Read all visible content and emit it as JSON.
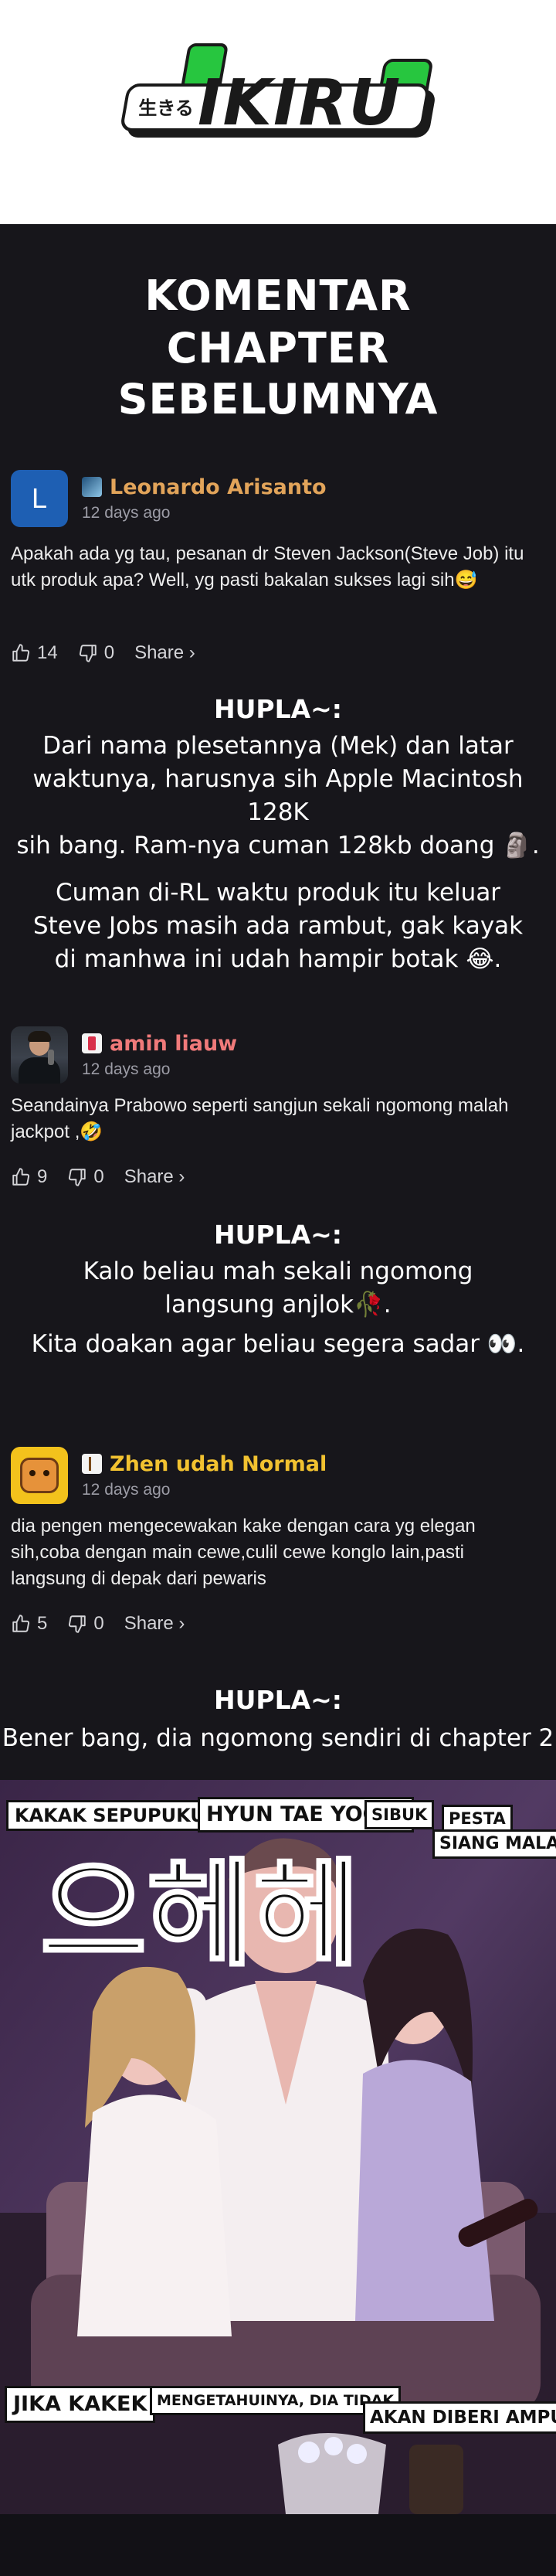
{
  "header": {
    "logo_jp": "生きる",
    "logo_text": "IKIRU"
  },
  "section": {
    "title_line1": "KOMENTAR",
    "title_line2": "CHAPTER SEBELUMNYA"
  },
  "comments": [
    {
      "avatar_letter": "L",
      "username": "Leonardo Arisanto",
      "username_color": "#e2a45a",
      "time": "12 days ago",
      "text": "Apakah ada yg tau, pesanan dr Steven Jackson(Steve Job) itu utk produk apa? Well, yg pasti bakalan sukses lagi sih😅",
      "likes": "14",
      "dislikes": "0",
      "share": "Share ›"
    },
    {
      "username": "amin liauw",
      "username_color": "#f07a7a",
      "time": "12 days ago",
      "text": "Seandainya Prabowo seperti sangjun sekali ngomong malah jackpot ,🤣",
      "likes": "9",
      "dislikes": "0",
      "share": "Share ›"
    },
    {
      "username": "Zhen udah Normal",
      "username_color": "#f2c230",
      "time": "12 days ago",
      "text": "dia pengen mengecewakan kake dengan cara yg elegan sih,coba dengan main cewe,culil cewe konglo lain,pasti langsung di depak dari pewaris",
      "likes": "5",
      "dislikes": "0",
      "share": "Share ›"
    }
  ],
  "replies": [
    {
      "head": "HUPLA~:",
      "lines": [
        "Dari nama plesetannya (Mek) dan latar",
        "waktunya, harusnya sih Apple Macintosh 128K",
        "sih bang. Ram-nya cuman 128kb doang 🗿.",
        "Cuman di-RL waktu produk itu keluar",
        "Steve Jobs masih ada rambut, gak kayak",
        "di manhwa ini udah hampir botak 😂."
      ]
    },
    {
      "head": "HUPLA~:",
      "lines": [
        "Kalo beliau mah sekali ngomong",
        "langsung anjlok🥀.",
        "Kita doakan agar beliau segera sadar 👀."
      ]
    },
    {
      "head": "HUPLA~:",
      "lines": [
        "Bener bang, dia ngomong sendiri di chapter 2"
      ]
    }
  ],
  "manga": {
    "caption1": "KAKAK SEPUPUKU,",
    "caption2": "HYUN TAE YOON,",
    "caption3": "SIBUK",
    "caption4": "PESTA",
    "caption5": "SIANG MALAM.",
    "caption6": "JIKA KAKEK",
    "caption7": "MENGETAHUINYA, DIA TIDAK",
    "caption8": "AKAN DIBERI AMPUN,",
    "sfx": "으헤헤"
  }
}
